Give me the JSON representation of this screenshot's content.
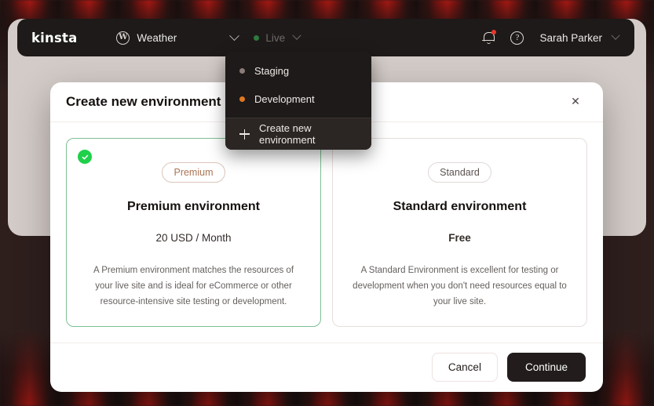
{
  "topbar": {
    "logo": "kinsta",
    "site_name": "Weather",
    "site_icon": "wordpress-icon",
    "wp_glyph": "W",
    "environment_label": "Live",
    "environment_dot_color": "#2f7a3e",
    "notification_icon": "bell-icon",
    "help_icon": "help-circle-icon",
    "help_glyph": "?",
    "user_name": "Sarah Parker"
  },
  "env_dropdown": {
    "items": [
      {
        "label": "Staging",
        "dot_color": "#8a7d78",
        "icon": "status-dot-icon"
      },
      {
        "label": "Development",
        "dot_color": "#e07820",
        "icon": "status-dot-icon"
      }
    ],
    "action": {
      "label": "Create new environment",
      "icon": "plus-icon"
    }
  },
  "modal": {
    "title": "Create new environment",
    "close_label": "✕",
    "options": [
      {
        "pill": "Premium",
        "title": "Premium environment",
        "price": "20 USD / Month",
        "description": "A Premium environment matches the resources of your live site and is ideal for eCommerce or other resource-intensive site testing or development.",
        "selected": true,
        "accent": "#ab7555"
      },
      {
        "pill": "Standard",
        "title": "Standard environment",
        "price": "Free",
        "description": "A Standard Environment is excellent for testing or development when you don't need resources equal to your live site.",
        "selected": false,
        "accent": "#5b5350"
      }
    ],
    "footer": {
      "cancel_label": "Cancel",
      "continue_label": "Continue"
    }
  },
  "colors": {
    "selected_border": "#7dbf93",
    "check_badge": "#1fd04a",
    "primary_button": "#221d1c",
    "panel": "#d3cbc7",
    "topbar": "#1d1a19"
  }
}
